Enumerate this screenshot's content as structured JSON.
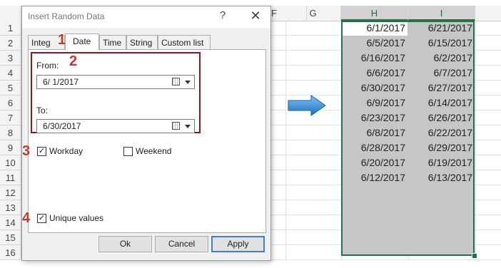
{
  "sheet": {
    "columns": {
      "F": "F",
      "G": "G",
      "H": "H",
      "I": "I"
    },
    "rows": [
      "1",
      "2",
      "3",
      "4",
      "5",
      "6",
      "7",
      "8",
      "9",
      "10",
      "11",
      "12",
      "13",
      "14",
      "15",
      "16"
    ],
    "col_h": [
      "6/1/2017",
      "6/5/2017",
      "6/16/2017",
      "6/6/2017",
      "6/30/2017",
      "6/9/2017",
      "6/23/2017",
      "6/8/2017",
      "6/28/2017",
      "6/20/2017",
      "6/12/2017"
    ],
    "col_i": [
      "6/21/2017",
      "6/15/2017",
      "6/2/2017",
      "6/7/2017",
      "6/27/2017",
      "6/14/2017",
      "6/26/2017",
      "6/22/2017",
      "6/29/2017",
      "6/19/2017",
      "6/13/2017"
    ]
  },
  "dialog": {
    "title": "Insert Random Data",
    "help": "?",
    "close": "✕",
    "tabs": [
      "Integ",
      "Date",
      "Time",
      "String",
      "Custom list"
    ],
    "from_label": "From:",
    "from_value": "6/  1/2017",
    "to_label": "To:",
    "to_value": "6/30/2017",
    "workday_label": "Workday",
    "weekend_label": "Weekend",
    "unique_label": "Unique values",
    "ok": "Ok",
    "cancel": "Cancel",
    "apply": "Apply"
  },
  "callouts": [
    "1",
    "2",
    "3",
    "4"
  ],
  "colors": {
    "accent_green": "#217346",
    "callout_red": "#c0392b",
    "box_red": "#8b1a1a",
    "arrow_blue": "#3a8fd8"
  }
}
